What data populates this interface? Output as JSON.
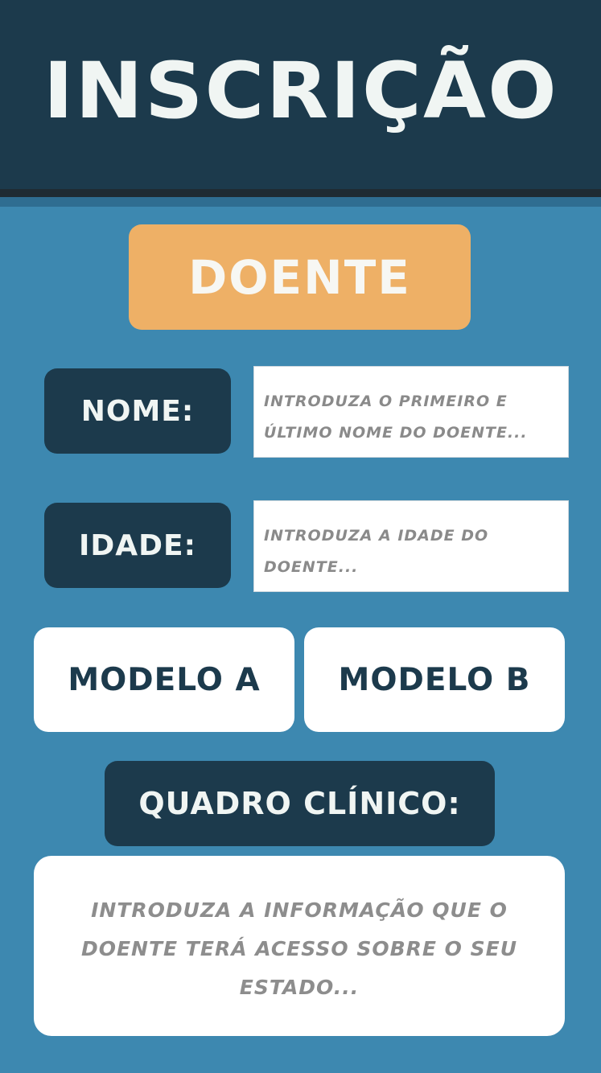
{
  "header": {
    "title": "Inscrição"
  },
  "section": {
    "label": "Doente"
  },
  "form": {
    "name_label": "Nome:",
    "name_placeholder": "Introduza o primeiro e último nome do doente...",
    "age_label": "Idade:",
    "age_placeholder": "Introduza a idade do doente...",
    "model_a_label": "Modelo A",
    "model_b_label": "Modelo B",
    "clinical_label": "Quadro Clínico:",
    "clinical_placeholder": "Introduza a informação que o doente terá acesso sobre o seu estado..."
  },
  "colors": {
    "header_bg": "#1c3a4c",
    "page_bg": "#3d88b0",
    "accent": "#eeb066",
    "text_light": "#f0f5f3",
    "placeholder": "#8a8a8a"
  }
}
